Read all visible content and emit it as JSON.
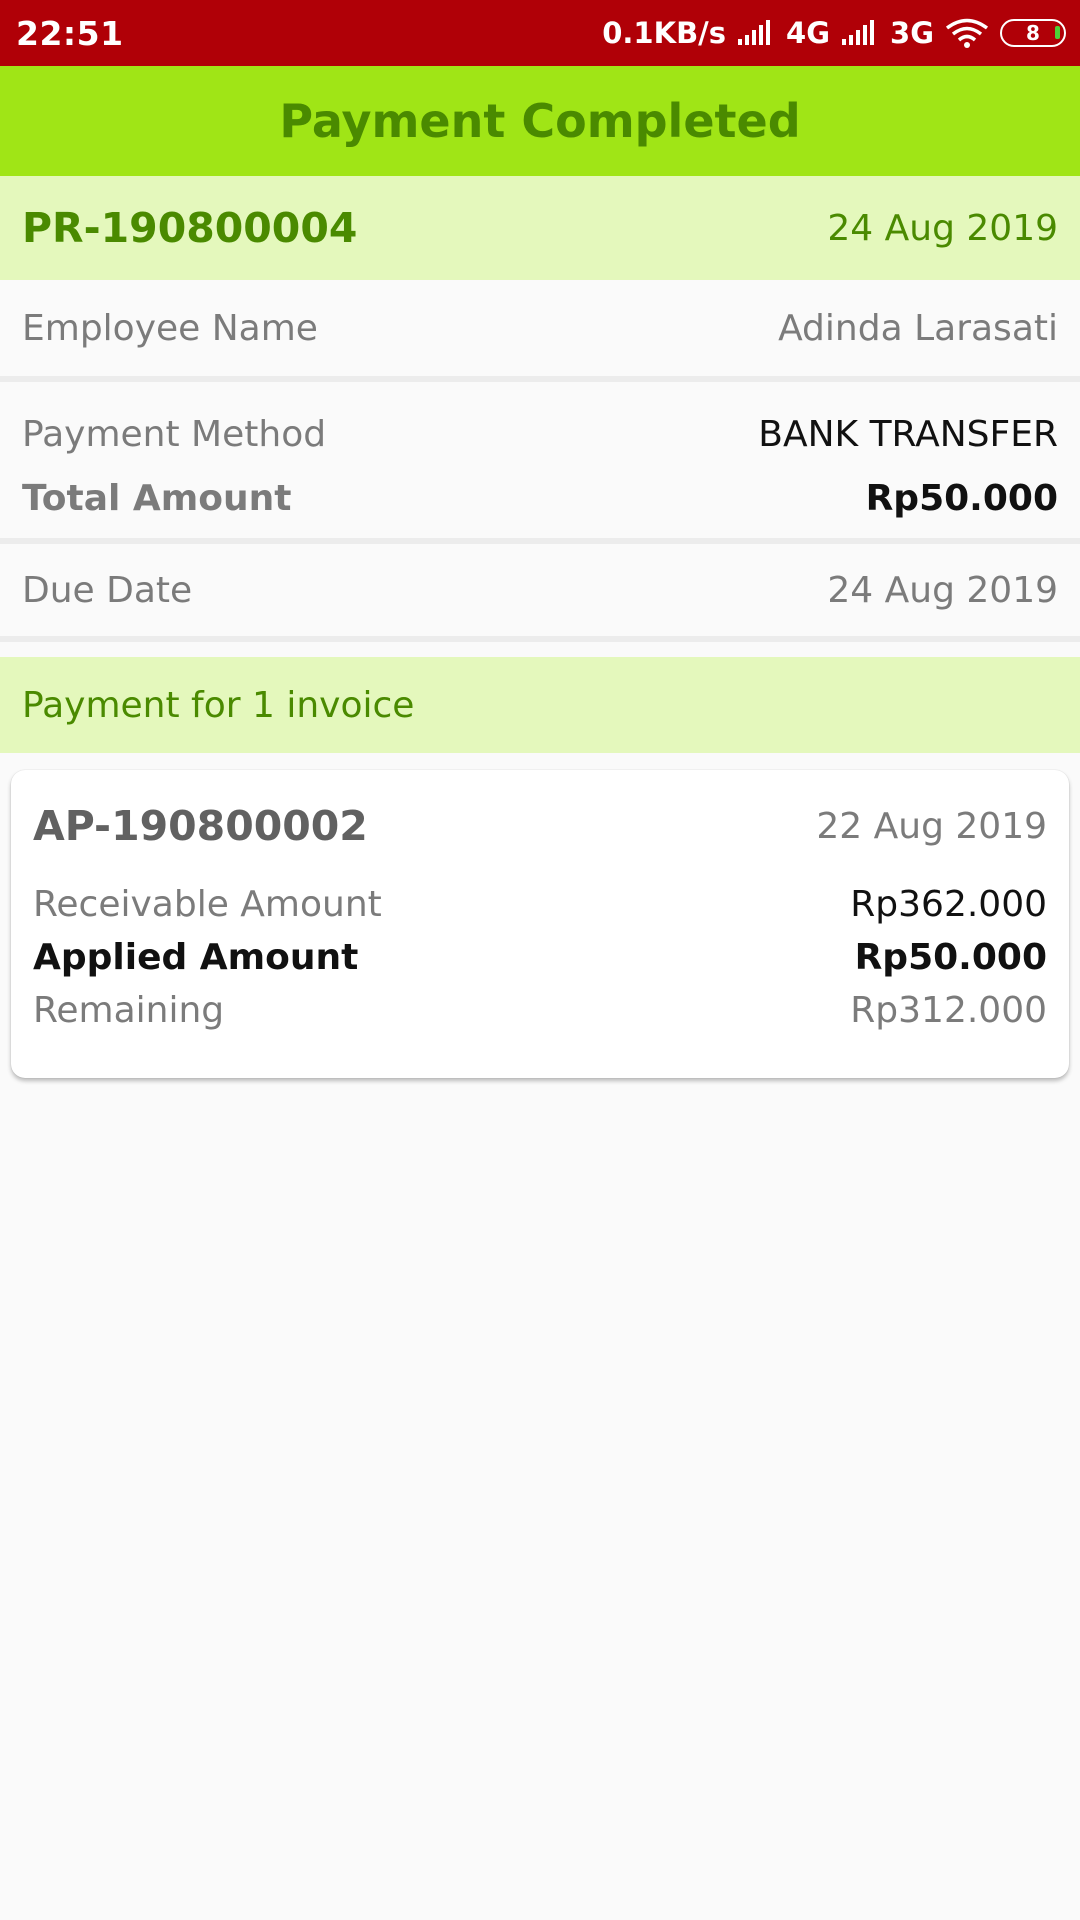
{
  "status_bar": {
    "time": "22:51",
    "network_speed": "0.1KB/s",
    "sim1": "4G",
    "sim2": "3G",
    "battery": "8",
    "background_color": "#b00007"
  },
  "title_bar": {
    "title": "Payment Completed",
    "background_color": "#a0e516",
    "text_color": "#4a8a00"
  },
  "payment_header": {
    "number": "PR-190800004",
    "date": "24 Aug 2019"
  },
  "details": {
    "employee_label": "Employee Name",
    "employee_value": "Adinda Larasati",
    "method_label": "Payment Method",
    "method_value": "BANK TRANSFER",
    "total_label": "Total Amount",
    "total_value": "Rp50.000",
    "due_label": "Due Date",
    "due_value": "24 Aug 2019"
  },
  "section": {
    "label": "Payment for 1 invoice"
  },
  "invoice": {
    "number": "AP-190800002",
    "date": "22 Aug 2019",
    "receivable_label": "Receivable Amount",
    "receivable_value": "Rp362.000",
    "applied_label": "Applied Amount",
    "applied_value": "Rp50.000",
    "remaining_label": "Remaining",
    "remaining_value": "Rp312.000"
  }
}
